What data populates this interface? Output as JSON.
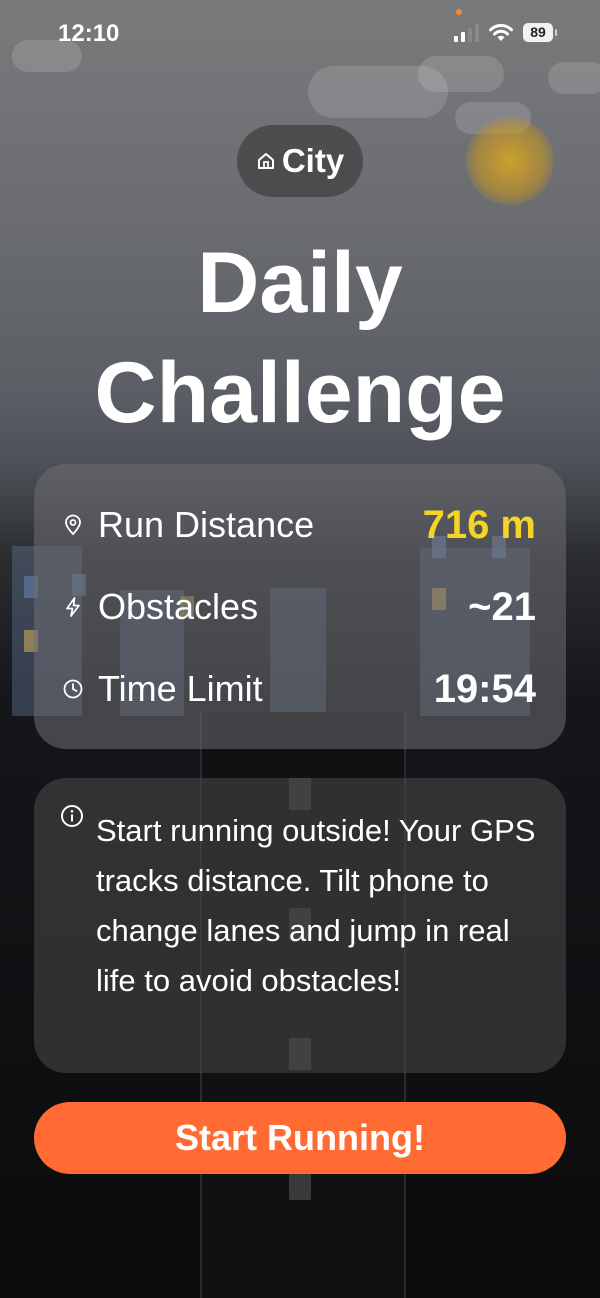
{
  "status_bar": {
    "time": "12:10",
    "battery": "89"
  },
  "theme": {
    "label": "City",
    "icon": "home-icon"
  },
  "title": {
    "line1": "Daily",
    "line2": "Challenge"
  },
  "stats": [
    {
      "icon": "map-pin-icon",
      "label": "Run Distance",
      "value": "716 m",
      "value_color": "#f5d327"
    },
    {
      "icon": "lightning-icon",
      "label": "Obstacles",
      "value": "~21",
      "value_color": "#ffffff"
    },
    {
      "icon": "clock-icon",
      "label": "Time Limit",
      "value": "19:54",
      "value_color": "#ffffff"
    }
  ],
  "info": {
    "icon": "info-icon",
    "text": "Start running outside! Your GPS tracks distance. Tilt phone to change lanes and jump in real life to avoid obstacles!"
  },
  "start_button": {
    "label": "Start Running!",
    "color": "#ff6b32"
  }
}
